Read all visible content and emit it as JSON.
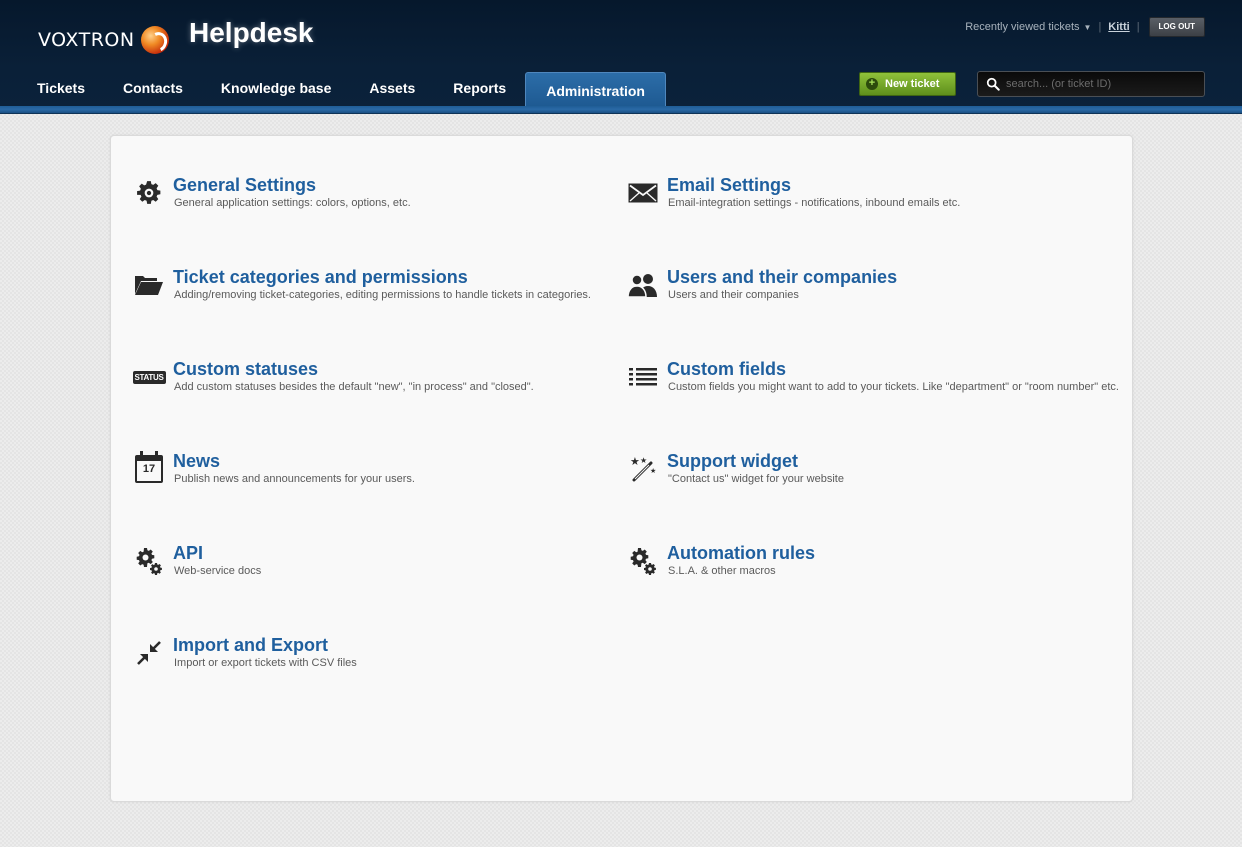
{
  "header": {
    "logo_text": "VOXTRON",
    "app_title": "Helpdesk",
    "recently_viewed": "Recently viewed tickets",
    "username": "Kitti",
    "logout_label": "LOG OUT",
    "new_ticket_label": "New ticket",
    "search_placeholder": "search... (or ticket ID)"
  },
  "nav": {
    "items": [
      {
        "label": "Tickets"
      },
      {
        "label": "Contacts"
      },
      {
        "label": "Knowledge base"
      },
      {
        "label": "Assets"
      },
      {
        "label": "Reports"
      },
      {
        "label": "Administration",
        "active": true
      }
    ]
  },
  "admin": {
    "items": [
      {
        "title": "General Settings",
        "desc": "General application settings: colors, options, etc.",
        "icon": "gear-icon"
      },
      {
        "title": "Email Settings",
        "desc": "Email-integration settings - notifications, inbound emails etc.",
        "icon": "envelope-icon"
      },
      {
        "title": "Ticket categories and permissions",
        "desc": "Adding/removing ticket-categories, editing permissions to handle tickets in categories.",
        "icon": "folder-icon"
      },
      {
        "title": "Users and their companies",
        "desc": "Users and their companies",
        "icon": "users-icon"
      },
      {
        "title": "Custom statuses",
        "desc": "Add custom statuses besides the default \"new\", \"in process\" and \"closed\".",
        "icon": "status-icon",
        "icon_text": "STATUS"
      },
      {
        "title": "Custom fields",
        "desc": "Custom fields you might want to add to your tickets. Like \"department\" or \"room number\" etc.",
        "icon": "list-icon"
      },
      {
        "title": "News",
        "desc": "Publish news and announcements for your users.",
        "icon": "calendar-icon",
        "icon_text": "17"
      },
      {
        "title": "Support widget",
        "desc": "\"Contact us\" widget for your website",
        "icon": "magic-wand-icon"
      },
      {
        "title": "API",
        "desc": "Web-service docs",
        "icon": "gears-icon"
      },
      {
        "title": "Automation rules",
        "desc": "S.L.A. & other macros",
        "icon": "gears-icon"
      },
      {
        "title": "Import and Export",
        "desc": "Import or export tickets with CSV files",
        "icon": "compress-arrows-icon"
      }
    ]
  },
  "colors": {
    "header_bg": "#0a2038",
    "accent_blue": "#1f5f9e",
    "new_ticket_green": "#6fa12a"
  }
}
